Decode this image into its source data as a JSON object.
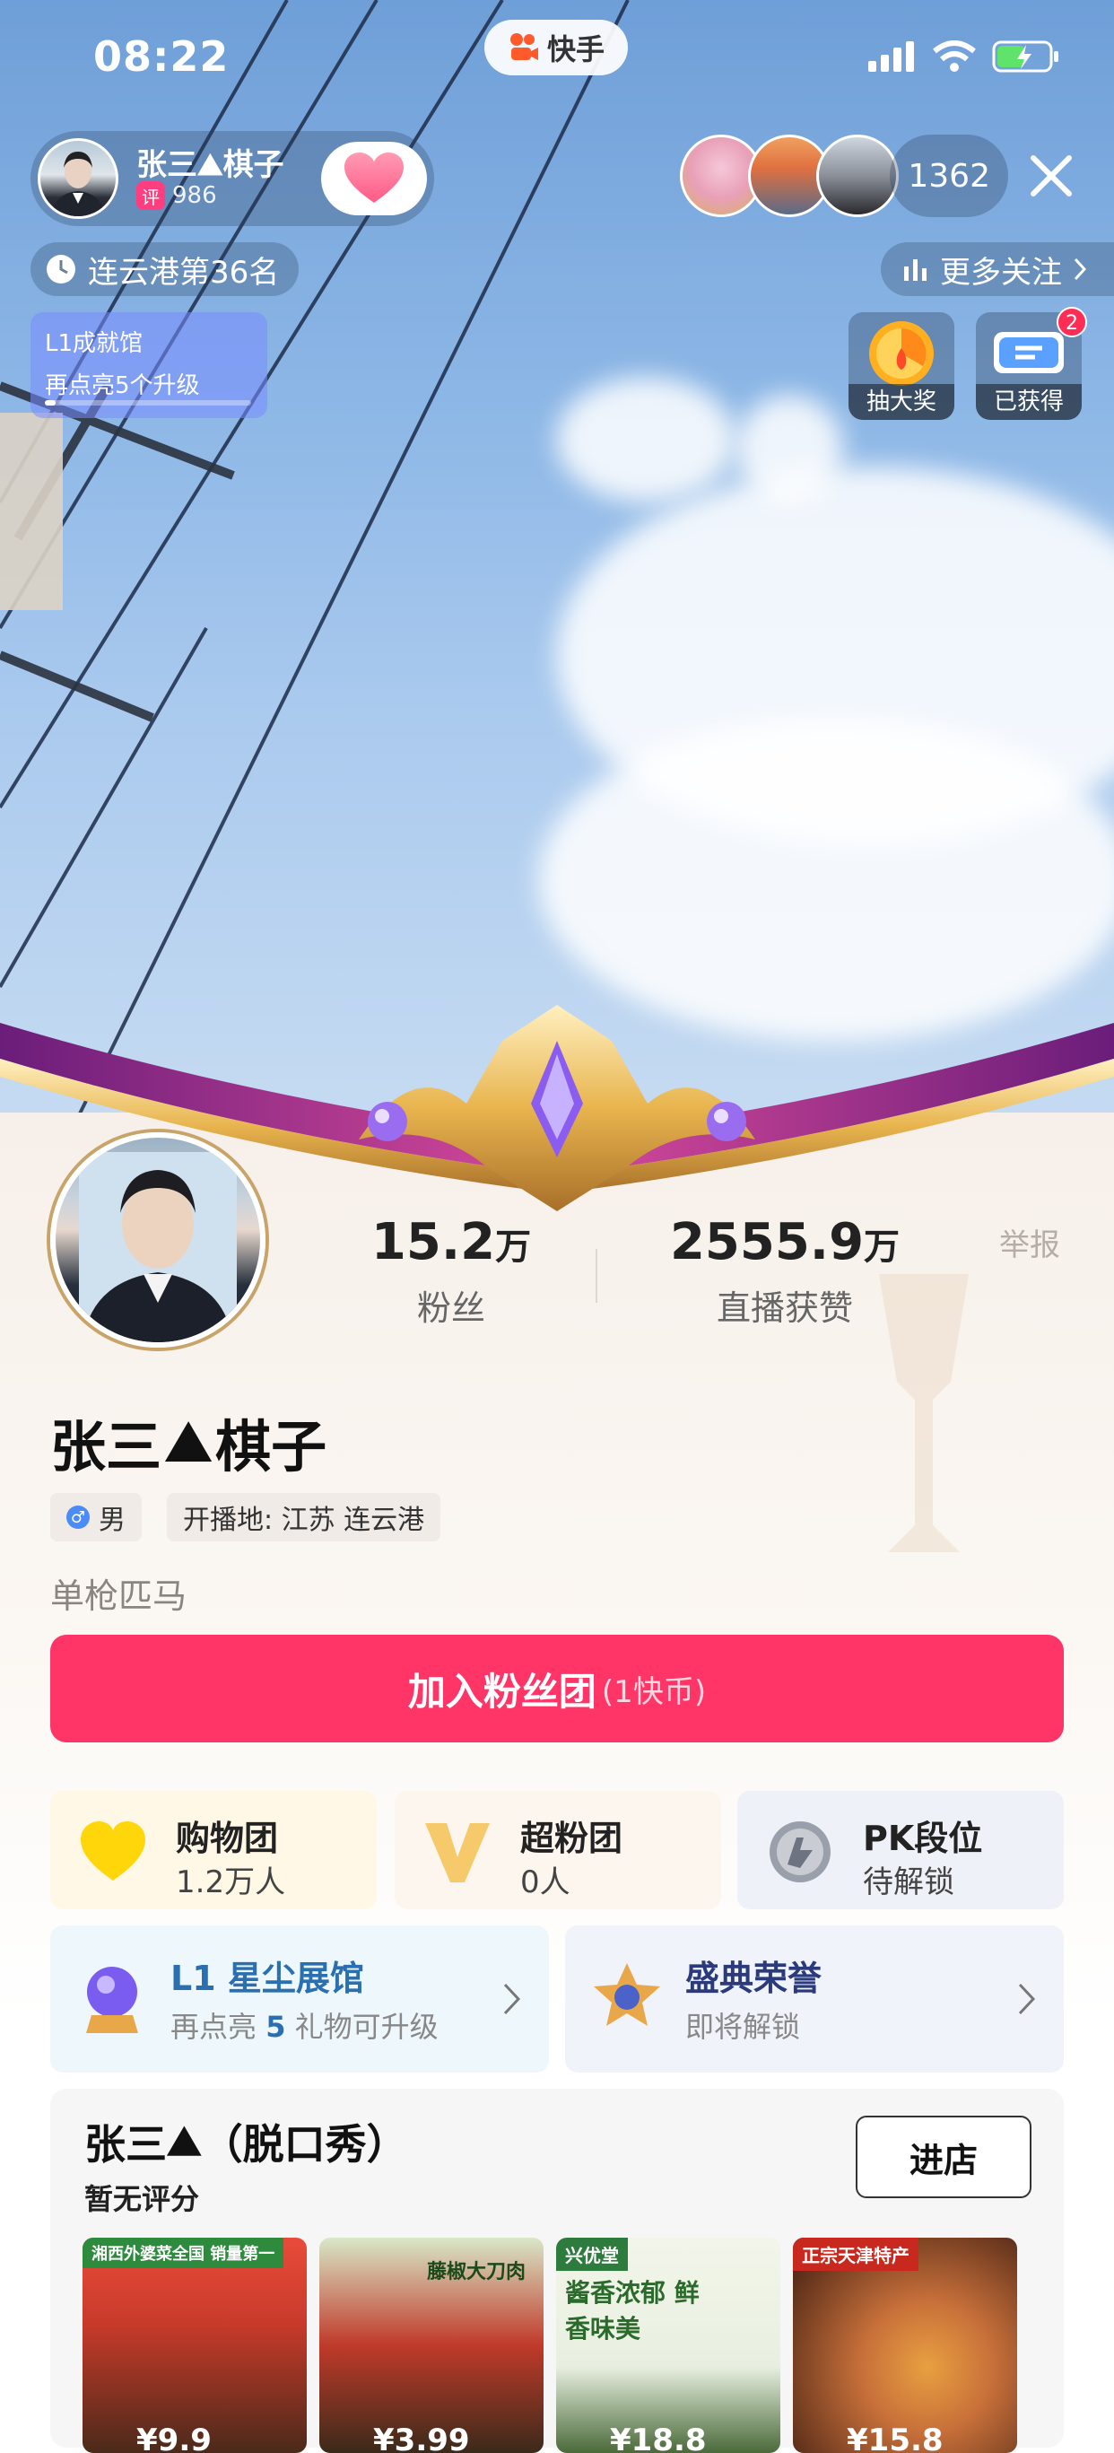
{
  "status_bar": {
    "time": "08:22",
    "app_name": "快手"
  },
  "host": {
    "name": "张三",
    "name_suffix": "棋子",
    "score_badge": "评",
    "score": "986"
  },
  "viewers": {
    "count": "1362"
  },
  "rank": {
    "text": "连云港第36名"
  },
  "more_follow": {
    "label": "更多关注"
  },
  "level_card": {
    "title": "L1成就馆",
    "subtitle": "再点亮5个升级",
    "progress": 0.05
  },
  "pendants": [
    {
      "label": "抽大奖"
    },
    {
      "label": "已获得",
      "badge": "2"
    }
  ],
  "profile": {
    "fans_value": "15.2",
    "fans_unit": "万",
    "fans_label": "粉丝",
    "likes_value": "2555.9",
    "likes_unit": "万",
    "likes_label": "直播获赞",
    "report": "举报",
    "name": "张三",
    "name_suffix": "棋子",
    "gender": "男",
    "location": "开播地: 江苏 连云港",
    "bio": "单枪匹马"
  },
  "join_button": {
    "label": "加入粉丝团",
    "sub": "(1快币)"
  },
  "mini_cards": [
    {
      "title": "购物团",
      "value": "1.2万人"
    },
    {
      "title": "超粉团",
      "value": "0人"
    },
    {
      "title": "PK段位",
      "value": "待解锁"
    }
  ],
  "wide_cards": [
    {
      "title": "L1 星尘展馆",
      "sub_prefix": "再点亮 ",
      "sub_num": "5",
      "sub_suffix": " 礼物可升级"
    },
    {
      "title": "盛典荣誉",
      "sub": "即将解锁"
    }
  ],
  "shop": {
    "title": "张三",
    "title_suffix": "（脱口秀）",
    "rating": "暂无评分",
    "button": "进店",
    "products": [
      {
        "tag": "湘西外婆菜全国 销量第一",
        "banner": "",
        "price": "¥9.9"
      },
      {
        "tag": "",
        "banner": "藤椒大刀肉",
        "price": "¥3.99"
      },
      {
        "tag": "兴优堂",
        "banner": "酱香浓郁 鲜香味美",
        "price": "¥18.8"
      },
      {
        "tag": "正宗天津特产",
        "banner": "",
        "price": "¥15.8"
      }
    ]
  },
  "colors": {
    "accent": "#ff3467",
    "blue_title": "#2a6fb0",
    "navy_title": "#2b3a7a"
  }
}
